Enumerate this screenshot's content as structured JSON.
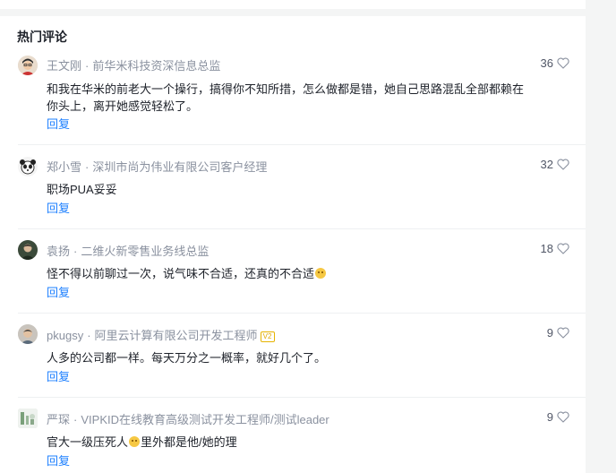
{
  "section_title": "热门评论",
  "comments": [
    {
      "author": "王文刚",
      "title": "前华米科技资深信息总监",
      "badge": "",
      "text_parts": [
        "和我在华米的前老大一个操行，搞得你不知所措，怎么做都是错，她自己思路混乱全部都赖在你头上，离开她感觉轻松了。"
      ],
      "likes": "36",
      "reply_label": "回复"
    },
    {
      "author": "郑小雪",
      "title": "深圳市尚为伟业有限公司客户经理",
      "badge": "",
      "text_parts": [
        "职场PUA妥妥"
      ],
      "likes": "32",
      "reply_label": "回复"
    },
    {
      "author": "袁扬",
      "title": "二维火新零售业务线总监",
      "badge": "",
      "text_parts": [
        "怪不得以前聊过一次，说气味不合适，还真的不合适"
      ],
      "likes": "18",
      "reply_label": "回复"
    },
    {
      "author": "pkugsy",
      "title": "阿里云计算有限公司开发工程师",
      "badge": "V2",
      "text_parts": [
        "人多的公司都一样。每天万分之一概率，就好几个了。"
      ],
      "likes": "9",
      "reply_label": "回复"
    },
    {
      "author": "严琛",
      "title": "VIPKID在线教育高级测试开发工程师/测试leader",
      "badge": "",
      "text_parts": [
        "官大一级压死人",
        "里外都是他/她的理"
      ],
      "likes": "9",
      "reply_label": "回复"
    }
  ]
}
